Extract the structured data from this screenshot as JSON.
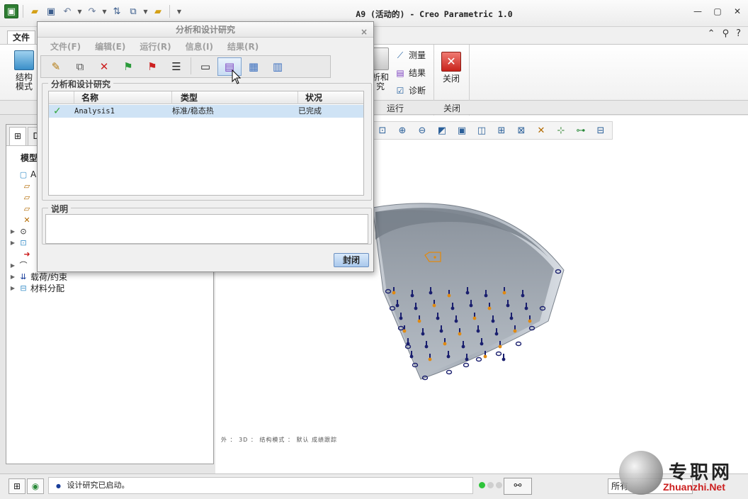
{
  "window": {
    "title": "A9 (活动的) - Creo Parametric 1.0",
    "minimize": "▭",
    "maximize": "▢",
    "close": "✕"
  },
  "quick_access": {
    "icons": [
      "new-icon",
      "open-icon",
      "save-icon",
      "undo-icon",
      "redo-icon",
      "regenerate-icon",
      "windows-icon",
      "close-window-icon",
      "customize-icon"
    ]
  },
  "ribbon": {
    "file_tab": "文件",
    "help_icons": [
      "⌃",
      "?",
      "✕"
    ],
    "left_button": "结构\n模式",
    "study_button": "析和\n究",
    "small_buttons": [
      "测量",
      "结果",
      "诊断"
    ],
    "close_button": "关闭",
    "group_labels": [
      "运行",
      "关闭"
    ]
  },
  "left_panel": {
    "title": "模型",
    "tab_label": "D",
    "tree": [
      {
        "arrow": "",
        "icon": "part-icon",
        "label": "A9."
      },
      {
        "arrow": "",
        "icon": "datum-plane-icon",
        "label": ""
      },
      {
        "arrow": "",
        "icon": "datum-plane-icon",
        "label": ""
      },
      {
        "arrow": "",
        "icon": "datum-plane-icon",
        "label": ""
      },
      {
        "arrow": "",
        "icon": "csys-icon",
        "label": ""
      },
      {
        "arrow": "▶",
        "icon": "feature-icon",
        "label": ""
      },
      {
        "arrow": "▶",
        "icon": "feature-icon",
        "label": ""
      },
      {
        "arrow": "",
        "icon": "insert-here-icon",
        "label": ""
      },
      {
        "arrow": "▶",
        "icon": "idealization-icon",
        "label": ""
      },
      {
        "arrow": "▶",
        "icon": "loads-icon",
        "label": "载荷/约束"
      },
      {
        "arrow": "▶",
        "icon": "material-icon",
        "label": "材料分配"
      }
    ]
  },
  "graphics": {
    "toolbar_icons": [
      "zoom-window-icon",
      "zoom-in-icon",
      "zoom-out-icon",
      "refit-icon",
      "repaint-icon",
      "view-manager-icon",
      "annotation-display-icon",
      "saved-orientations-icon",
      "datum-display-icon",
      "spin-center-icon",
      "mech-display-icon"
    ],
    "view_info": "外 ： 3D ： 结构模式 ： 默认 成绩跟踪"
  },
  "dialog": {
    "title": "分析和设计研究",
    "close": "×",
    "menu": [
      "文件(F)",
      "编辑(E)",
      "运行(R)",
      "信息(I)",
      "结果(R)"
    ],
    "toolbar_icons": [
      "edit-icon",
      "copy-icon",
      "delete-icon",
      "start-run-icon",
      "stop-run-icon",
      "status-icon",
      "summary-icon",
      "configure-icon",
      "display-results-icon",
      "batch-icon"
    ],
    "studies_group": "分析和设计研究",
    "columns": [
      "名称",
      "类型",
      "状况"
    ],
    "rows": [
      {
        "status_icon": "✓",
        "name": "Analysis1",
        "type": "标准/稳态热",
        "state": "已完成"
      }
    ],
    "description_group": "说明",
    "description": "",
    "close_button": "封闭"
  },
  "status_bar": {
    "message": "设计研究已启动。",
    "filter": "所有",
    "binoculars": "find-icon"
  },
  "watermark": {
    "cn": "专职网",
    "en": "Zhuanzhi.Net"
  },
  "colors": {
    "bowl_surface": "#9aa3ad",
    "constraint_blue": "#1a1f6e",
    "load_orange": "#e08a12",
    "selection_blue": "#cfe3f5"
  }
}
